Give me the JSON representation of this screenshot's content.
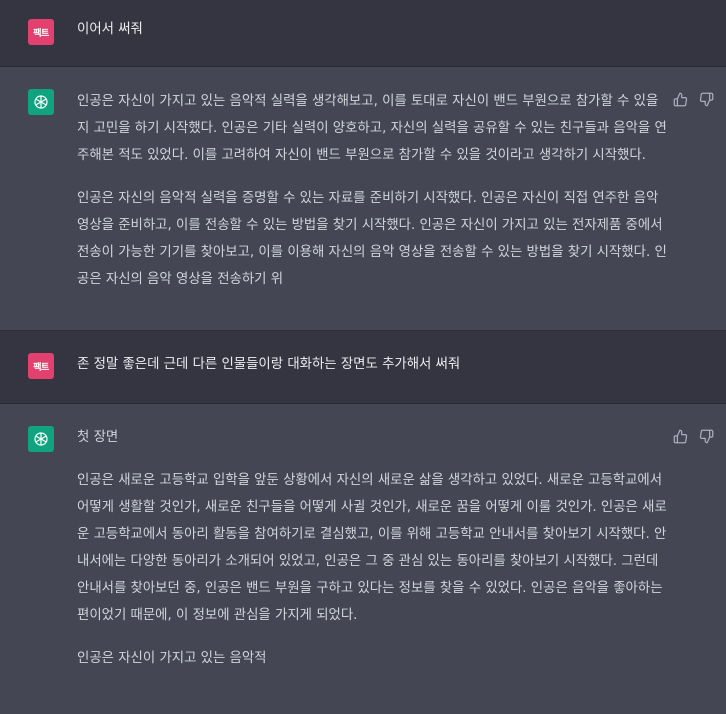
{
  "user_avatar_label": "팩트",
  "turns": [
    {
      "role": "user",
      "text": "이어서 써줘"
    },
    {
      "role": "assistant",
      "paragraphs": [
        "인공은 자신이 가지고 있는 음악적 실력을 생각해보고, 이를 토대로 자신이 밴드 부원으로 참가할 수 있을지 고민을 하기 시작했다. 인공은 기타 실력이 양호하고, 자신의 실력을 공유할 수 있는 친구들과 음악을 연주해본 적도 있었다. 이를 고려하여 자신이 밴드 부원으로 참가할 수 있을 것이라고 생각하기 시작했다.",
        "인공은 자신의 음악적 실력을 증명할 수 있는 자료를 준비하기 시작했다. 인공은 자신이 직접 연주한 음악 영상을 준비하고, 이를 전송할 수 있는 방법을 찾기 시작했다. 인공은 자신이 가지고 있는 전자제품 중에서 전송이 가능한 기기를 찾아보고, 이를 이용해 자신의 음악 영상을 전송할 수 있는 방법을 찾기 시작했다. 인공은 자신의 음악 영상을 전송하기 위"
      ]
    },
    {
      "role": "user",
      "text": "존 정말 좋은데 근데 다른 인물들이랑 대화하는 장면도 추가해서 써줘"
    },
    {
      "role": "assistant",
      "paragraphs": [
        "첫 장면",
        "인공은 새로운 고등학교 입학을 앞둔 상황에서 자신의 새로운 삶을 생각하고 있었다. 새로운 고등학교에서 어떻게 생활할 것인가, 새로운 친구들을 어떻게 사귈 것인가, 새로운 꿈을 어떻게 이룰 것인가. 인공은 새로운 고등학교에서 동아리 활동을 참여하기로 결심했고, 이를 위해 고등학교 안내서를 찾아보기 시작했다. 안내서에는 다양한 동아리가 소개되어 있었고, 인공은 그 중 관심 있는 동아리를 찾아보기 시작했다. 그런데 안내서를 찾아보던 중, 인공은 밴드 부원을 구하고 있다는 정보를 찾을 수 있었다. 인공은 음악을 좋아하는 편이었기 때문에, 이 정보에 관심을 가지게 되었다.",
        "인공은 자신이 가지고 있는 음악적"
      ]
    }
  ],
  "colors": {
    "user_bg": "#343541",
    "assistant_bg": "#444654",
    "user_avatar": "#e2416f",
    "assistant_avatar": "#10a37f"
  },
  "icons": {
    "assistant_avatar": "openai-logo-icon",
    "like": "thumbs-up-icon",
    "dislike": "thumbs-down-icon"
  }
}
